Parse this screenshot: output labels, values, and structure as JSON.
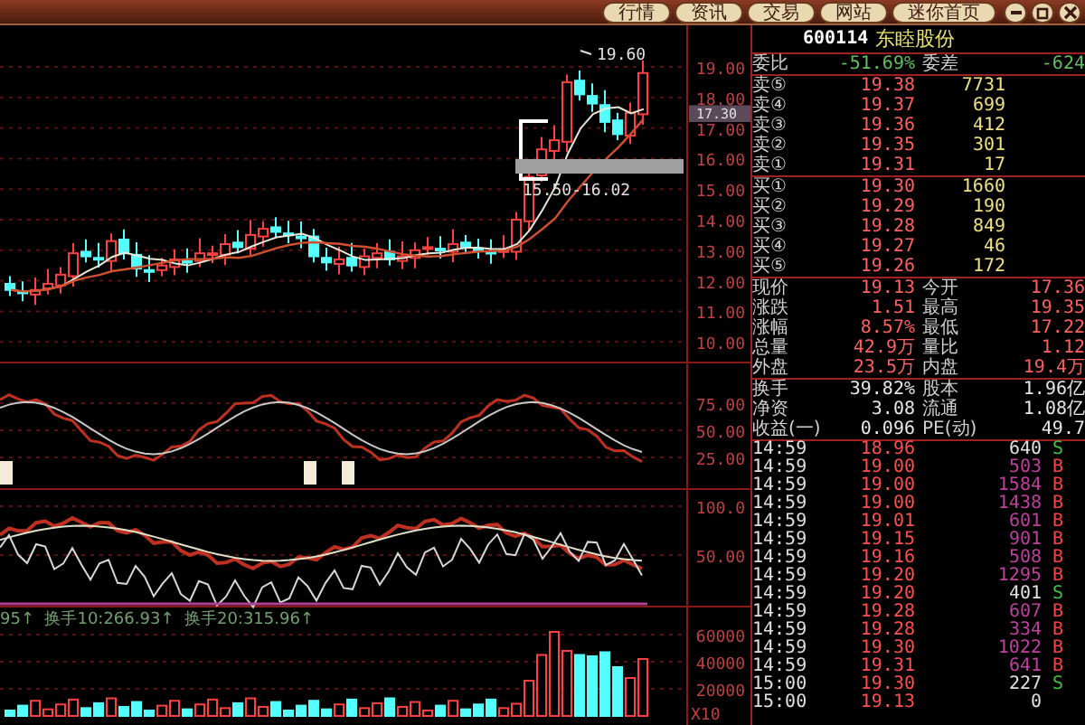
{
  "toolbar": {
    "tabs": [
      {
        "label": "行情",
        "selected": false
      },
      {
        "label": "资讯",
        "selected": false
      },
      {
        "label": "交易",
        "selected": false
      },
      {
        "label": "网站",
        "selected": false
      },
      {
        "label": "迷你首页",
        "selected": false
      }
    ]
  },
  "price_panel": {
    "axis_labels": [
      "19.00",
      "18.00",
      "17.00",
      "16.00",
      "15.00",
      "14.00",
      "13.00",
      "12.00",
      "11.00",
      "10.00"
    ],
    "cursor_price": "17.30",
    "high_label": "19.60",
    "range_label": "15.50-16.02"
  },
  "kdj_panel": {
    "axis_labels": [
      "75.00",
      "50.00",
      "25.00"
    ]
  },
  "indicator_panel": {
    "axis_labels": [
      "100.0",
      "50.00"
    ]
  },
  "volume_panel": {
    "legend": [
      "95↑",
      "换手10:266.93↑",
      "换手20:315.96↑"
    ],
    "axis_labels": [
      "60000",
      "40000",
      "20000"
    ],
    "scale_label": "X10"
  },
  "quote": {
    "code": "600114",
    "name": "东睦股份",
    "ratio_label": "委比",
    "ratio": "-51.69%",
    "diff_label": "委差",
    "diff": "-624",
    "sells": [
      {
        "label": "卖⑤",
        "price": "19.38",
        "volume": "7731"
      },
      {
        "label": "卖④",
        "price": "19.37",
        "volume": "699"
      },
      {
        "label": "卖③",
        "price": "19.36",
        "volume": "412"
      },
      {
        "label": "卖②",
        "price": "19.35",
        "volume": "301"
      },
      {
        "label": "卖①",
        "price": "19.31",
        "volume": "17"
      }
    ],
    "buys": [
      {
        "label": "买①",
        "price": "19.30",
        "volume": "1660"
      },
      {
        "label": "买②",
        "price": "19.29",
        "volume": "190"
      },
      {
        "label": "买③",
        "price": "19.28",
        "volume": "849"
      },
      {
        "label": "买④",
        "price": "19.27",
        "volume": "46"
      },
      {
        "label": "买⑤",
        "price": "19.26",
        "volume": "172"
      }
    ],
    "stats": [
      {
        "label": "现价",
        "value": "19.13",
        "label2": "今开",
        "value2": "17.36"
      },
      {
        "label": "涨跌",
        "value": "1.51",
        "label2": "最高",
        "value2": "19.35"
      },
      {
        "label": "涨幅",
        "value": "8.57%",
        "label2": "最低",
        "value2": "17.22"
      },
      {
        "label": "总量",
        "value": "42.9万",
        "label2": "量比",
        "value2": "1.12"
      },
      {
        "label": "外盘",
        "value": "23.5万",
        "label2": "内盘",
        "value2": "19.4万"
      }
    ],
    "fundamentals": [
      {
        "label": "换手",
        "value": "39.82%",
        "label2": "股本",
        "value2": "1.96亿"
      },
      {
        "label": "净资",
        "value": "3.08",
        "label2": "流通",
        "value2": "1.08亿"
      },
      {
        "label": "收益(一)",
        "value": "0.096",
        "label2": "PE(动)",
        "value2": "49.7"
      }
    ],
    "ticks": [
      {
        "time": "14:59",
        "price": "18.96",
        "volume": "640",
        "side": "S",
        "kind": "sell"
      },
      {
        "time": "14:59",
        "price": "19.00",
        "volume": "503",
        "side": "B",
        "kind": "buy"
      },
      {
        "time": "14:59",
        "price": "19.00",
        "volume": "1584",
        "side": "B",
        "kind": "buy"
      },
      {
        "time": "14:59",
        "price": "19.00",
        "volume": "1438",
        "side": "B",
        "kind": "buy"
      },
      {
        "time": "14:59",
        "price": "19.01",
        "volume": "601",
        "side": "B",
        "kind": "buy"
      },
      {
        "time": "14:59",
        "price": "19.15",
        "volume": "901",
        "side": "B",
        "kind": "buy"
      },
      {
        "time": "14:59",
        "price": "19.16",
        "volume": "508",
        "side": "B",
        "kind": "buy"
      },
      {
        "time": "14:59",
        "price": "19.20",
        "volume": "1295",
        "side": "B",
        "kind": "buy"
      },
      {
        "time": "14:59",
        "price": "19.20",
        "volume": "401",
        "side": "S",
        "kind": "sell"
      },
      {
        "time": "14:59",
        "price": "19.28",
        "volume": "607",
        "side": "B",
        "kind": "buy"
      },
      {
        "time": "14:59",
        "price": "19.28",
        "volume": "334",
        "side": "B",
        "kind": "buy"
      },
      {
        "time": "14:59",
        "price": "19.30",
        "volume": "1022",
        "side": "B",
        "kind": "buy"
      },
      {
        "time": "14:59",
        "price": "19.31",
        "volume": "641",
        "side": "B",
        "kind": "buy"
      },
      {
        "time": "15:00",
        "price": "19.30",
        "volume": "227",
        "side": "S",
        "kind": "sell"
      },
      {
        "time": "15:00",
        "price": "19.13",
        "volume": "0",
        "kind": "none"
      }
    ]
  }
}
